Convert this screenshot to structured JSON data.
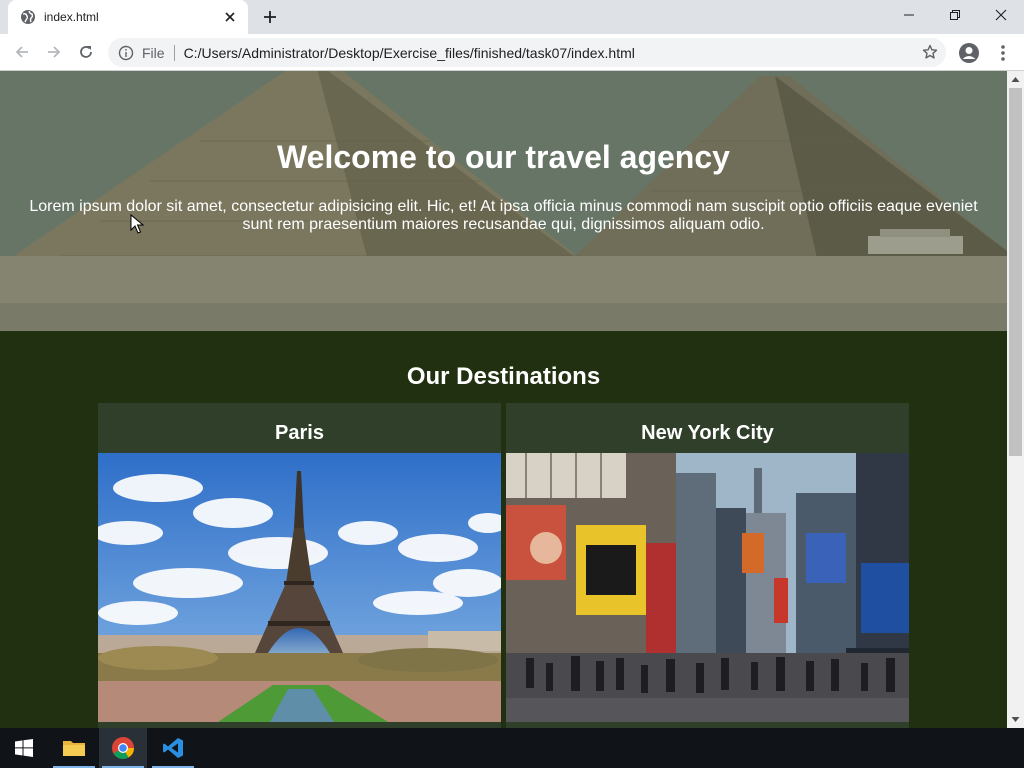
{
  "browser": {
    "tab_title": "index.html",
    "scheme_label": "File",
    "url": "C:/Users/Administrator/Desktop/Exercise_files/finished/task07/index.html"
  },
  "hero": {
    "heading": "Welcome to our travel agency",
    "paragraph": "Lorem ipsum dolor sit amet, consectetur adipisicing elit. Hic, et! At ipsa officia minus commodi nam suscipit optio officiis eaque eveniet sunt rem praesentium maiores recusandae qui, dignissimos aliquam odio."
  },
  "destinations": {
    "title": "Our Destinations",
    "cards": [
      {
        "name": "Paris"
      },
      {
        "name": "New York City"
      }
    ]
  },
  "colors": {
    "page_bg": "#223012",
    "card_bg": "#2f3f29",
    "accent": "#7fb4ea"
  },
  "icons": [
    "globe-icon",
    "close-icon",
    "plus-icon",
    "minimize-icon",
    "maximize-icon",
    "window-close-icon",
    "back-icon",
    "forward-icon",
    "reload-icon",
    "info-icon",
    "star-icon",
    "profile-icon",
    "menu-icon",
    "windows-start-icon",
    "file-explorer-icon",
    "chrome-icon",
    "vscode-icon"
  ]
}
